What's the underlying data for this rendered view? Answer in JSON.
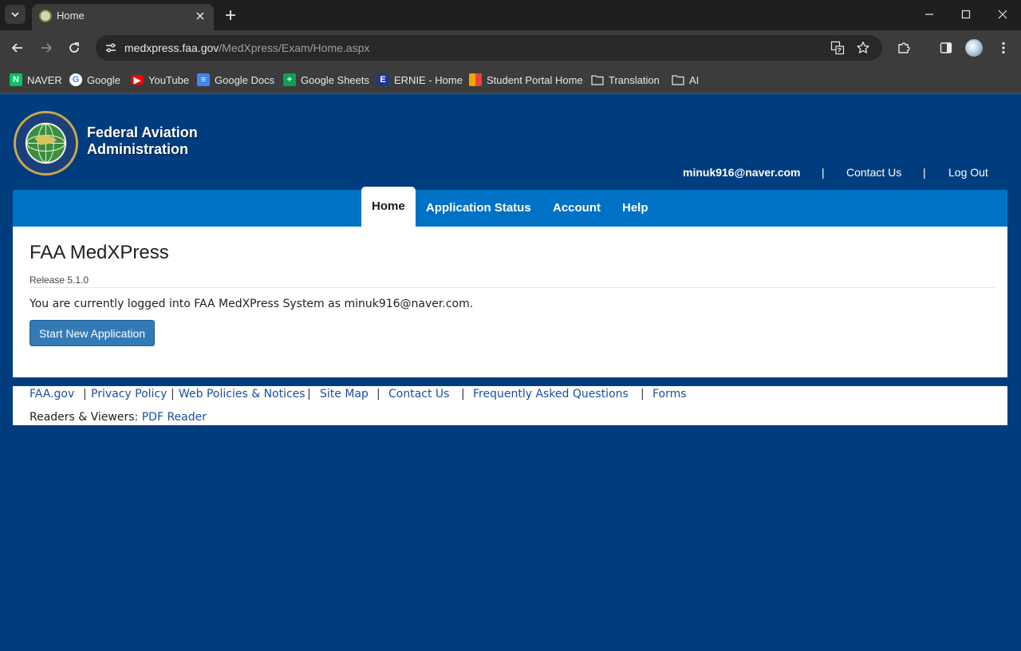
{
  "browser": {
    "tab_title": "Home",
    "url_host": "medxpress.faa.gov",
    "url_path": "/MedXpress/Exam/Home.aspx",
    "bookmarks": [
      {
        "label": "NAVER",
        "icon": "naver-icon",
        "color": "#03c75a"
      },
      {
        "label": "Google",
        "icon": "google-icon",
        "color": "#4285f4"
      },
      {
        "label": "YouTube",
        "icon": "youtube-icon",
        "color": "#ff0000"
      },
      {
        "label": "Google Docs",
        "icon": "docs-icon",
        "color": "#4285f4"
      },
      {
        "label": "Google Sheets",
        "icon": "sheets-icon",
        "color": "#0f9d58"
      },
      {
        "label": "ERNIE - Home",
        "icon": "ernie-icon",
        "color": "#1a3a8a"
      },
      {
        "label": "Student Portal Home",
        "icon": "portal-icon",
        "color": "#f4a300"
      },
      {
        "label": "Translation",
        "icon": "folder-icon",
        "color": "#e8e8e8"
      },
      {
        "label": "AI",
        "icon": "folder-icon",
        "color": "#e8e8e8"
      }
    ]
  },
  "header": {
    "brand_line1": "Federal Aviation",
    "brand_line2": "Administration",
    "user_email": "minuk916@naver.com",
    "separator": "|",
    "contact_us": "Contact Us",
    "log_out": "Log Out"
  },
  "nav": {
    "items": [
      "Home",
      "Application Status",
      "Account",
      "Help"
    ],
    "active": "Home"
  },
  "main": {
    "title": "FAA MedXPress",
    "release": "Release 5.1.0",
    "message": "You are currently logged into FAA MedXPress System as minuk916@naver.com.",
    "start_button": "Start New Application"
  },
  "footer": {
    "links": [
      "FAA.gov",
      "Privacy Policy",
      "Web Policies & Notices",
      "Site Map",
      "Contact Us",
      "Frequently Asked Questions",
      "Forms"
    ],
    "separator": "|",
    "readers_label": "Readers & Viewers:",
    "pdf_reader": "PDF Reader"
  },
  "colors": {
    "page_bg": "#003d7e",
    "nav_bg": "#0072c6",
    "button_bg": "#337ab7",
    "link": "#1a4fa0"
  }
}
